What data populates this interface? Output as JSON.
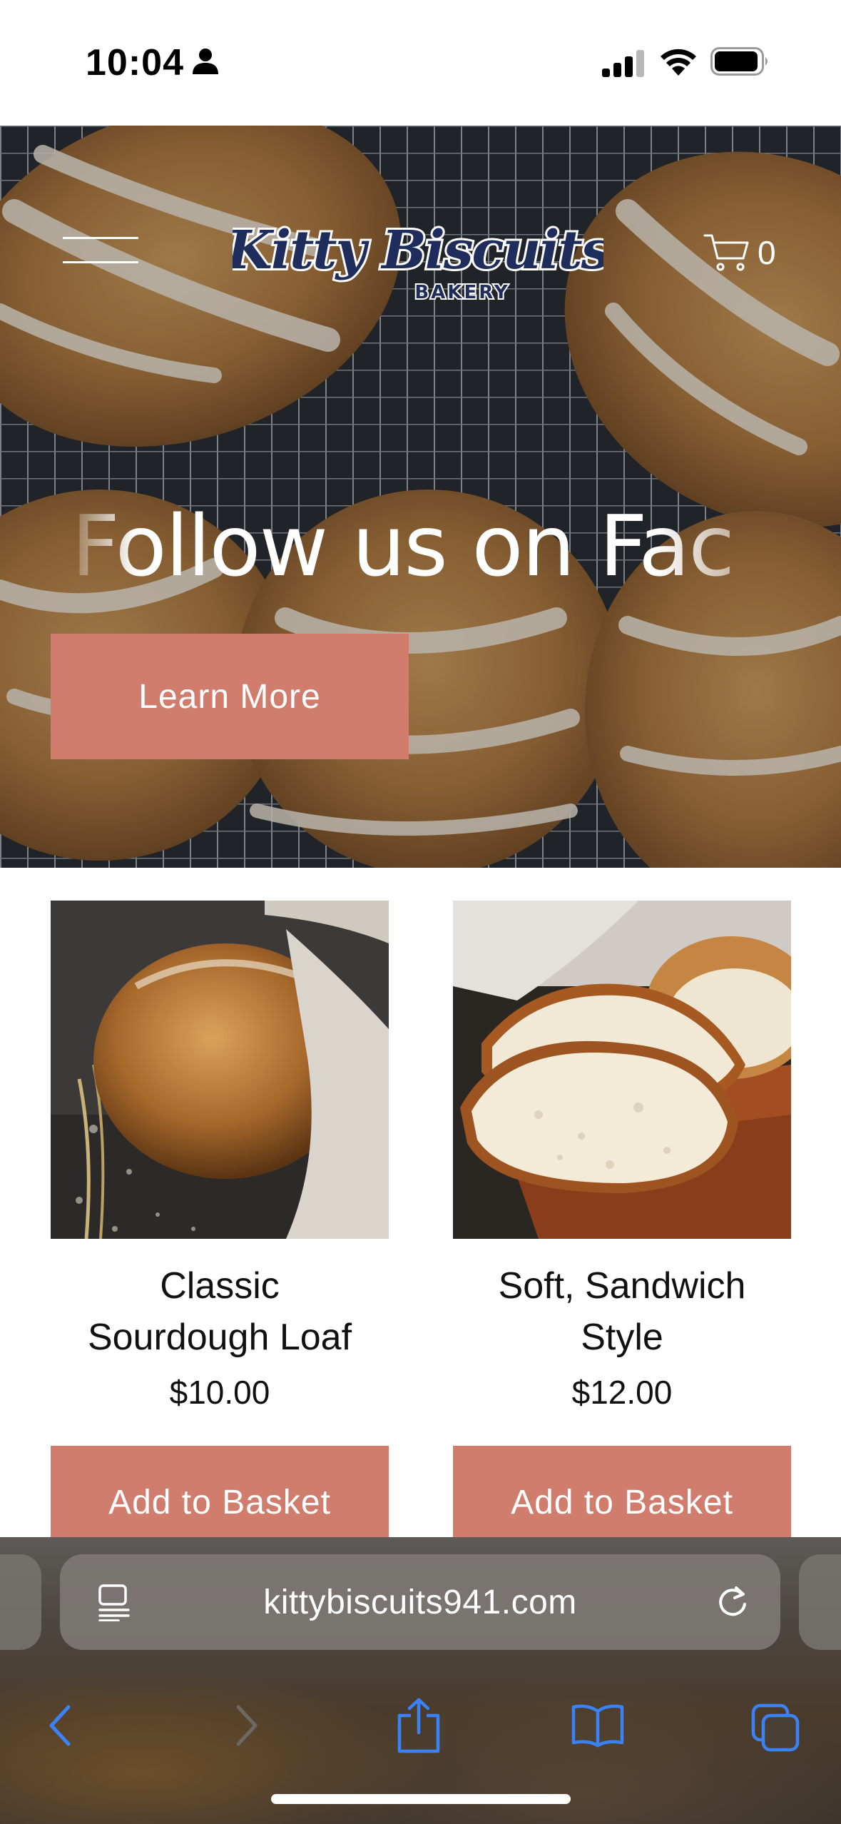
{
  "status_bar": {
    "time": "10:04",
    "person_icon": "person-fill-icon",
    "signal_icon": "cellular-signal-icon",
    "wifi_icon": "wifi-icon",
    "battery_icon": "battery-icon"
  },
  "header": {
    "menu_icon": "hamburger-menu-icon",
    "logo": {
      "name": "Kitty Biscuits",
      "subtitle": "BAKERY"
    },
    "cart_icon": "shopping-cart-icon",
    "cart_count": "0"
  },
  "hero": {
    "heading": "Follow us on Fac",
    "button_label": "Learn More"
  },
  "products": [
    {
      "title_line1": "Classic",
      "title_line2": "Sourdough Loaf",
      "price": "$10.00",
      "button_label": "Add to Basket"
    },
    {
      "title_line1": "Soft, Sandwich",
      "title_line2": "Style",
      "price": "$12.00",
      "button_label": "Add to Basket"
    }
  ],
  "browser": {
    "url": "kittybiscuits941.com",
    "reader_icon": "reader-mode-icon",
    "reload_icon": "reload-icon",
    "toolbar_icons": [
      "back-icon",
      "forward-icon",
      "share-icon",
      "bookmarks-icon",
      "tabs-icon"
    ]
  },
  "colors": {
    "accent": "#d17d6d",
    "logo_navy": "#1f2d5c",
    "ios_blue": "#3a82f7",
    "text": "#111111"
  }
}
